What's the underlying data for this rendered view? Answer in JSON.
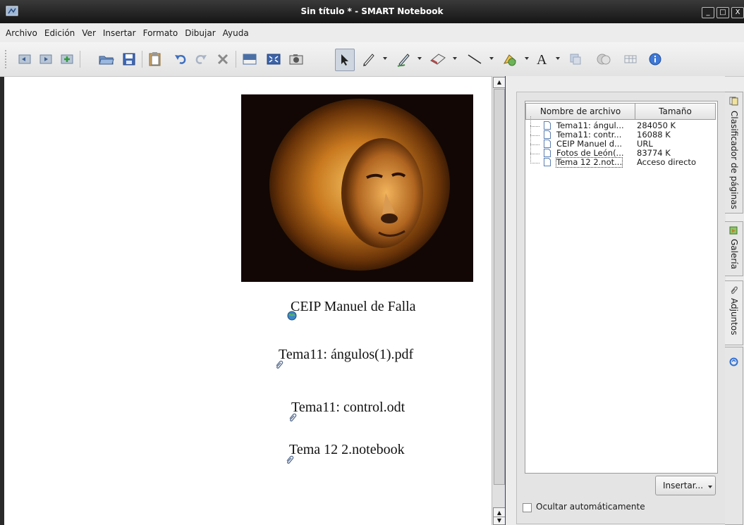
{
  "window": {
    "title": "Sin título * - SMART Notebook",
    "controls": [
      "_",
      "□",
      "X"
    ]
  },
  "menu": [
    "Archivo",
    "Edición",
    "Ver",
    "Insertar",
    "Formato",
    "Dibujar",
    "Ayuda"
  ],
  "toolbar": {
    "icons": [
      "previous-page-icon",
      "next-page-icon",
      "add-page-icon",
      "open-file-icon",
      "save-icon",
      "paste-icon",
      "undo-icon",
      "redo-icon",
      "delete-icon",
      "screen-shade-icon",
      "full-screen-icon",
      "capture-icon",
      "select-icon",
      "pen-icon",
      "creative-pen-icon",
      "eraser-icon",
      "line-icon",
      "shape-icon",
      "text-icon",
      "fill-icon",
      "properties-icon",
      "table-icon",
      "info-icon"
    ]
  },
  "page": {
    "image_alt": "lion-photo",
    "items": [
      {
        "text": "CEIP Manuel de Falla",
        "icon": "link-globe-icon"
      },
      {
        "text": "Tema11: ángulos(1).pdf",
        "icon": "attachment-clip-icon"
      },
      {
        "text": "Tema11: control.odt",
        "icon": "attachment-clip-icon"
      },
      {
        "text": "Tema 12 2.notebook",
        "icon": "attachment-clip-icon"
      }
    ]
  },
  "attachments": {
    "columns": [
      "Nombre de archivo",
      "Tamaño"
    ],
    "rows": [
      {
        "name": "Tema11: ángul...",
        "size": "284050 K"
      },
      {
        "name": "Tema11: contr...",
        "size": "16088 K"
      },
      {
        "name": "CEIP Manuel d...",
        "size": "URL"
      },
      {
        "name": "Fotos de León(...",
        "size": "83774 K"
      },
      {
        "name": "Tema 12 2.not...",
        "size": "Acceso directo"
      }
    ],
    "insert_label": "Insertar...",
    "autohide_label": "Ocultar automáticamente",
    "autohide_checked": false
  },
  "tabs": [
    "Clasificador de páginas",
    "Galería",
    "Adjuntos"
  ],
  "colors": {
    "titlebar": "#151515",
    "selection": "#cfd6e0",
    "accent": "#2f6fd4"
  }
}
